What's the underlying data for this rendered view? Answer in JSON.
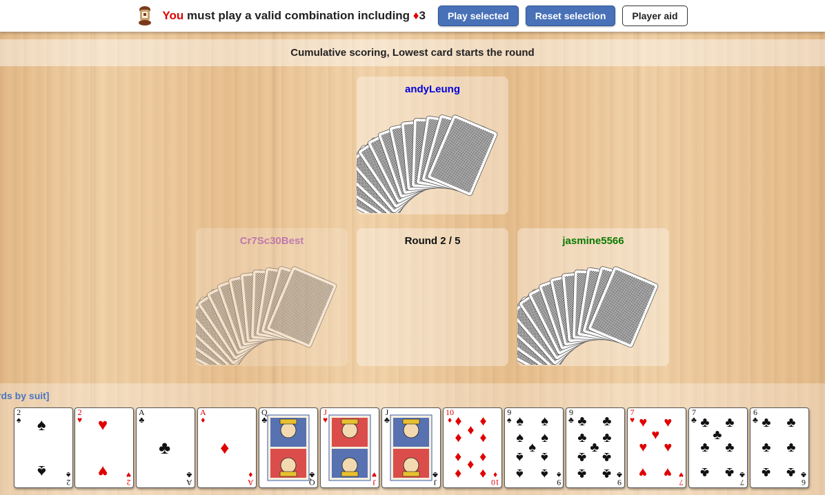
{
  "status": {
    "you": "You",
    "message": "must play a valid combination including",
    "suit_symbol": "♦",
    "rank": "3"
  },
  "buttons": {
    "play_selected": "Play selected",
    "reset_selection": "Reset selection",
    "player_aid": "Player aid"
  },
  "info": "Cumulative scoring, Lowest card starts the round",
  "players": {
    "top": {
      "name": "andyLeung",
      "color": "#0000dd"
    },
    "left": {
      "name": "Cr7Sc30Best",
      "color": "#9f3fbf"
    },
    "right": {
      "name": "jasmine5566",
      "color": "#0a7a00"
    }
  },
  "round": "Round 2 / 5",
  "sort_link": "rds by suit]",
  "hand": [
    {
      "rank": "2",
      "suit": "♠"
    },
    {
      "rank": "2",
      "suit": "♥"
    },
    {
      "rank": "A",
      "suit": "♣"
    },
    {
      "rank": "A",
      "suit": "♦"
    },
    {
      "rank": "Q",
      "suit": "♣"
    },
    {
      "rank": "J",
      "suit": "♥"
    },
    {
      "rank": "J",
      "suit": "♣"
    },
    {
      "rank": "10",
      "suit": "♦"
    },
    {
      "rank": "9",
      "suit": "♠"
    },
    {
      "rank": "9",
      "suit": "♣"
    },
    {
      "rank": "7",
      "suit": "♥"
    },
    {
      "rank": "7",
      "suit": "♣"
    },
    {
      "rank": "6",
      "suit": "♣"
    }
  ]
}
